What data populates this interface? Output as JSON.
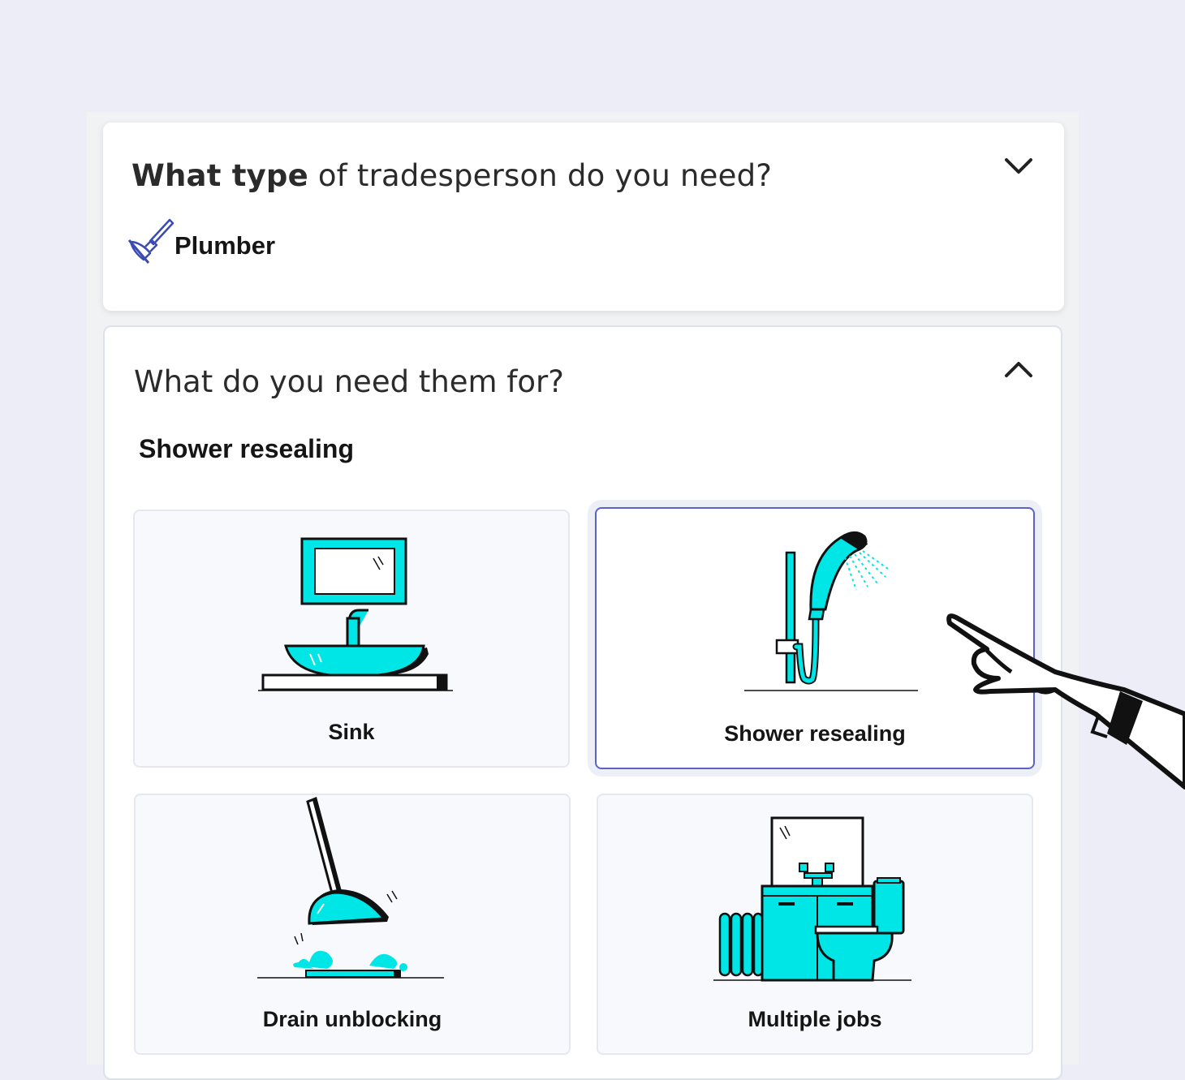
{
  "question1": {
    "bold": "What type",
    "rest": " of tradesperson do you need?",
    "selected_trade": "Plumber"
  },
  "question2": {
    "text": "What do you need them for?",
    "selected_label": "Shower resealing"
  },
  "options": [
    {
      "label": "Sink",
      "icon": "sink-icon",
      "selected": false
    },
    {
      "label": "Shower resealing",
      "icon": "shower-icon",
      "selected": true
    },
    {
      "label": "Drain unblocking",
      "icon": "plunger-icon",
      "selected": false
    },
    {
      "label": "Multiple jobs",
      "icon": "bathroom-icon",
      "selected": false
    }
  ],
  "colors": {
    "accent": "#00e5e5",
    "selected_border": "#5b63c7",
    "plunger_icon": "#3a4bb3"
  }
}
